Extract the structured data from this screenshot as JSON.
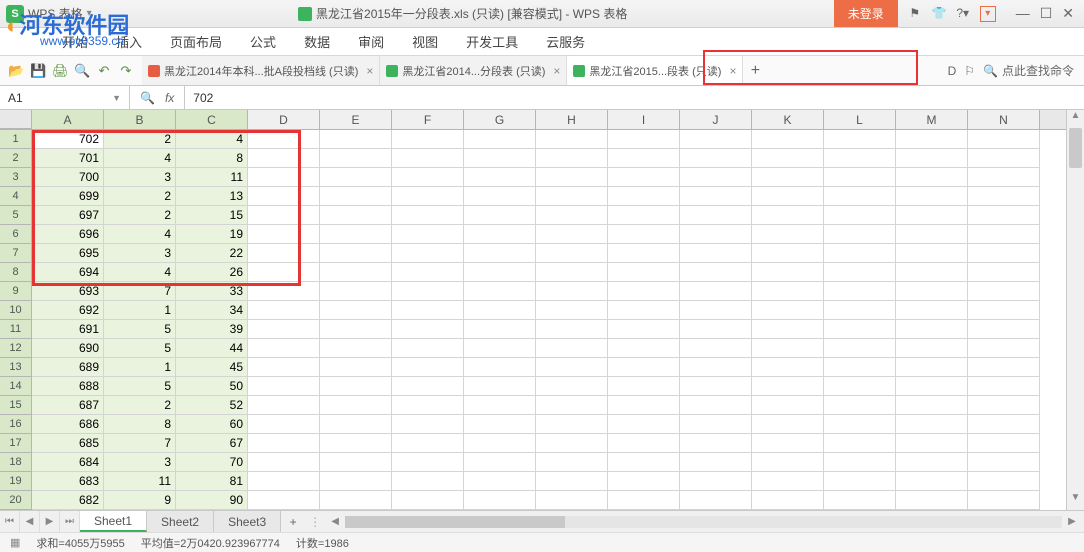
{
  "titlebar": {
    "app_name": "WPS 表格",
    "doc_title": "黑龙江省2015年一分段表.xls (只读) [兼容模式] - WPS 表格",
    "not_logged": "未登录"
  },
  "watermark": {
    "main": "河东软件园",
    "sub": "www.pc0359.cn"
  },
  "menu": {
    "items": [
      "开始",
      "插入",
      "页面布局",
      "公式",
      "数据",
      "审阅",
      "视图",
      "开发工具",
      "云服务"
    ]
  },
  "doc_tabs": {
    "tabs": [
      {
        "label": "黑龙江2014年本科...批A段投档线 (只读)",
        "icon": "w"
      },
      {
        "label": "黑龙江省2014...分段表 (只读)",
        "icon": "s"
      },
      {
        "label": "黑龙江省2015...段表 (只读)",
        "icon": "s",
        "active": true
      }
    ]
  },
  "toolbar_right": {
    "search_placeholder": "点此查找命令"
  },
  "formula": {
    "name_box": "A1",
    "value": "702"
  },
  "columns": [
    "A",
    "B",
    "C",
    "D",
    "E",
    "F",
    "G",
    "H",
    "I",
    "J",
    "K",
    "L",
    "M",
    "N"
  ],
  "rows": [
    {
      "n": 1,
      "a": "702",
      "b": "2",
      "c": "4"
    },
    {
      "n": 2,
      "a": "701",
      "b": "4",
      "c": "8"
    },
    {
      "n": 3,
      "a": "700",
      "b": "3",
      "c": "11"
    },
    {
      "n": 4,
      "a": "699",
      "b": "2",
      "c": "13"
    },
    {
      "n": 5,
      "a": "697",
      "b": "2",
      "c": "15"
    },
    {
      "n": 6,
      "a": "696",
      "b": "4",
      "c": "19"
    },
    {
      "n": 7,
      "a": "695",
      "b": "3",
      "c": "22"
    },
    {
      "n": 8,
      "a": "694",
      "b": "4",
      "c": "26"
    },
    {
      "n": 9,
      "a": "693",
      "b": "7",
      "c": "33"
    },
    {
      "n": 10,
      "a": "692",
      "b": "1",
      "c": "34"
    },
    {
      "n": 11,
      "a": "691",
      "b": "5",
      "c": "39"
    },
    {
      "n": 12,
      "a": "690",
      "b": "5",
      "c": "44"
    },
    {
      "n": 13,
      "a": "689",
      "b": "1",
      "c": "45"
    },
    {
      "n": 14,
      "a": "688",
      "b": "5",
      "c": "50"
    },
    {
      "n": 15,
      "a": "687",
      "b": "2",
      "c": "52"
    },
    {
      "n": 16,
      "a": "686",
      "b": "8",
      "c": "60"
    },
    {
      "n": 17,
      "a": "685",
      "b": "7",
      "c": "67"
    },
    {
      "n": 18,
      "a": "684",
      "b": "3",
      "c": "70"
    },
    {
      "n": 19,
      "a": "683",
      "b": "11",
      "c": "81"
    },
    {
      "n": 20,
      "a": "682",
      "b": "9",
      "c": "90"
    }
  ],
  "sheets": {
    "tabs": [
      "Sheet1",
      "Sheet2",
      "Sheet3"
    ],
    "active": 0
  },
  "status": {
    "sum": "求和=4055万5955",
    "avg": "平均值=2万0420.923967774",
    "count": "计数=1986"
  }
}
